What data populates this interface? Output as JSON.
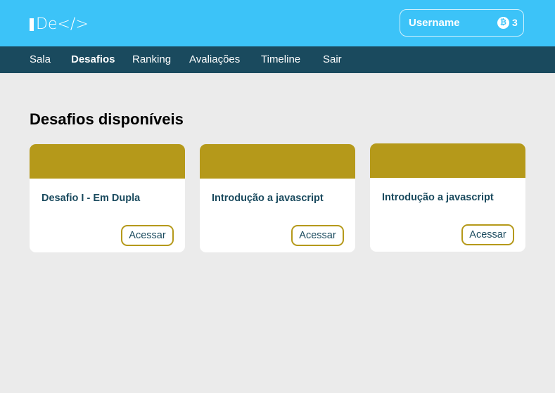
{
  "colors": {
    "header_bg": "#3cc3f8",
    "nav_bg": "#1a4a5e",
    "page_bg": "#ebebeb",
    "card_banner": "#b5991a",
    "text_dark": "#1a4a5e"
  },
  "header": {
    "logo_text": "De</>",
    "username": "Username",
    "coin_icon": "bitcoin-icon",
    "coin_symbol": "₿",
    "coin_count": "3"
  },
  "nav": {
    "items": [
      {
        "label": "Sala",
        "active": false
      },
      {
        "label": "Desafios",
        "active": true
      },
      {
        "label": "Ranking",
        "active": false
      },
      {
        "label": "Avaliações",
        "active": false
      },
      {
        "label": "Timeline",
        "active": false
      },
      {
        "label": "Sair",
        "active": false
      }
    ]
  },
  "main": {
    "title": "Desafios disponíveis",
    "cards": [
      {
        "title": "Desafio I - Em Dupla",
        "button": "Acessar"
      },
      {
        "title": "Introdução a javascript",
        "button": "Acessar"
      },
      {
        "title": "Introdução a javascript",
        "button": "Acessar"
      }
    ]
  }
}
